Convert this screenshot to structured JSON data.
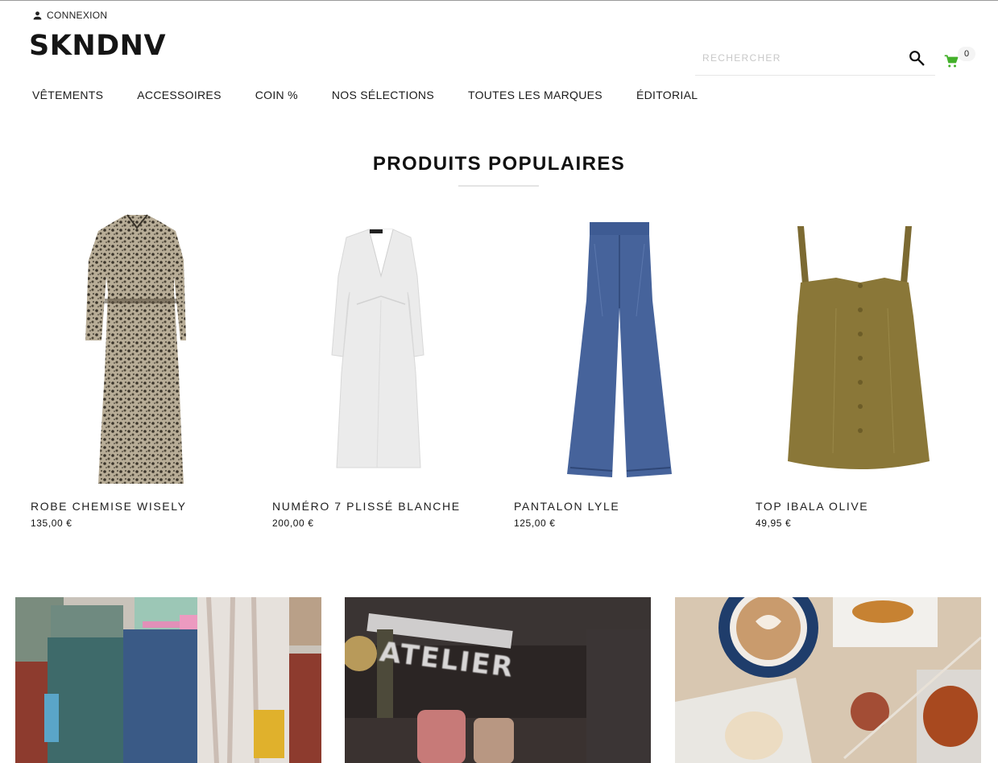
{
  "header": {
    "login_label": "CONNEXION",
    "logo": "SKNDNV",
    "search_placeholder": "RECHERCHER",
    "cart_count": "0",
    "cart_color": "#43b02a"
  },
  "nav": {
    "items": [
      "VÊTEMENTS",
      "ACCESSOIRES",
      "COIN %",
      "NOS SÉLECTIONS",
      "TOUTES LES MARQUES",
      "ÉDITORIAL"
    ]
  },
  "popular": {
    "title": "PRODUITS POPULAIRES",
    "products": [
      {
        "name": "ROBE CHEMISE WISELY",
        "price": "135,00 €",
        "image": "printed-shirt-dress"
      },
      {
        "name": "NUMÉRO 7 PLISSÉ BLANCHE",
        "price": "200,00 €",
        "image": "white-plisse-dress"
      },
      {
        "name": "PANTALON LYLE",
        "price": "125,00 €",
        "image": "denim-wide-trousers"
      },
      {
        "name": "TOP IBALA OLIVE",
        "price": "49,95 €",
        "image": "olive-buttoned-top"
      }
    ]
  },
  "banners": {
    "atelier_text": "ATELIER"
  }
}
